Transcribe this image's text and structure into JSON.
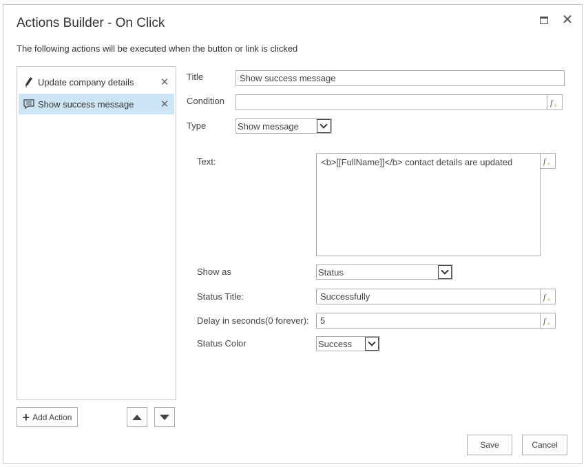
{
  "dialog": {
    "title": "Actions Builder - On Click",
    "subtitle": "The following actions will be executed when the button or link is clicked"
  },
  "window_controls": {
    "maximize_icon": "maximize-icon",
    "close_icon": "close-icon",
    "close_glyph": "✕"
  },
  "actions": {
    "items": [
      {
        "label": "Update company details",
        "icon": "pencil-icon",
        "remove_glyph": "✕",
        "selected": false
      },
      {
        "label": "Show success message",
        "icon": "message-icon",
        "remove_glyph": "✕",
        "selected": true
      }
    ],
    "add_label": "Add Action",
    "add_glyph": "+"
  },
  "form": {
    "title_label": "Title",
    "title_value": "Show success message",
    "condition_label": "Condition",
    "condition_value": "",
    "type_label": "Type",
    "type_value": "Show message",
    "text_label": "Text:",
    "text_value": "<b>[[FullName]]</b> contact details are updated",
    "show_as_label": "Show as",
    "show_as_value": "Status",
    "status_title_label": "Status Title:",
    "status_title_value": "Successfully",
    "delay_label": "Delay in seconds(0 forever):",
    "delay_value": "5",
    "status_color_label": "Status Color",
    "status_color_value": "Success",
    "fx_icon": "fx-formula-icon"
  },
  "footer": {
    "save_label": "Save",
    "cancel_label": "Cancel"
  },
  "colors": {
    "selected_bg": "#cde6f7",
    "border": "#ababab",
    "fx_gold": "#c8a030"
  }
}
